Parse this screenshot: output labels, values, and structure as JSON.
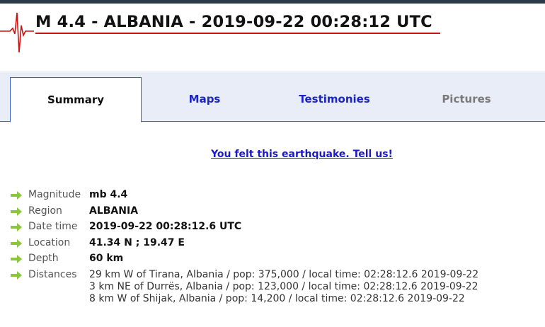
{
  "header": {
    "title": "M 4.4 - ALBANIA - 2019-09-22 00:28:12 UTC"
  },
  "tabs": [
    {
      "label": "Summary",
      "state": "active"
    },
    {
      "label": "Maps",
      "state": "link"
    },
    {
      "label": "Testimonies",
      "state": "link"
    },
    {
      "label": "Pictures",
      "state": "disabled"
    }
  ],
  "felt_link": "You felt this earthquake. Tell us!",
  "details": {
    "magnitude": {
      "label": "Magnitude",
      "value": "mb 4.4"
    },
    "region": {
      "label": "Region",
      "value": "ALBANIA"
    },
    "datetime": {
      "label": "Date time",
      "value": "2019-09-22 00:28:12.6 UTC"
    },
    "location": {
      "label": "Location",
      "value": "41.34 N ; 19.47 E"
    },
    "depth": {
      "label": "Depth",
      "value": "60 km"
    },
    "distances": {
      "label": "Distances",
      "lines": [
        "29 km W of Tirana, Albania / pop: 375,000 / local time: 02:28:12.6 2019-09-22",
        "3 km NE of Durrës, Albania / pop: 123,000 / local time: 02:28:12.6 2019-09-22",
        "8 km W of Shijak, Albania / pop: 14,200 / local time: 02:28:12.6 2019-09-22"
      ]
    }
  },
  "colors": {
    "accent_red": "#cc1111",
    "link_blue": "#1a24c8",
    "arrow_green": "#8cc63f",
    "tab_bg": "#e8edf7"
  }
}
